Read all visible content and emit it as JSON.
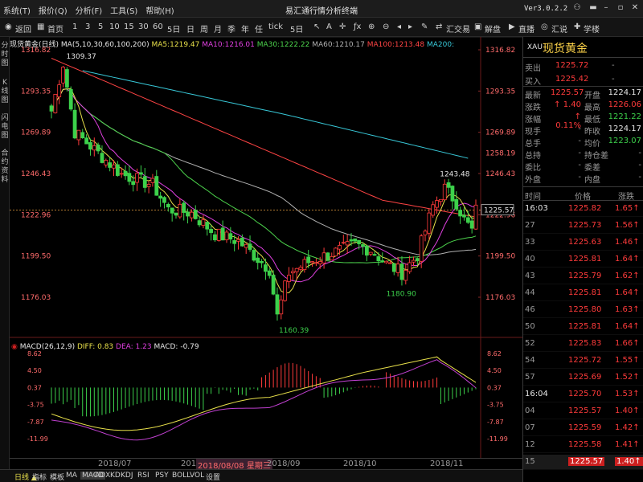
{
  "window": {
    "menus": [
      "系统(T)",
      "报价(Q)",
      "分析(F)",
      "工具(S)",
      "帮助(H)"
    ],
    "title": "易汇通行情分析终端",
    "version": "Ver3.0.2.2"
  },
  "toolbar": {
    "back": "返回",
    "home": "首页",
    "periods": [
      "1",
      "3",
      "5",
      "10",
      "15",
      "30",
      "60",
      "5日",
      "日",
      "周",
      "月",
      "季",
      "年",
      "任",
      "tick",
      "5日"
    ],
    "right_tools": [
      "汇交易",
      "解盘",
      "直播",
      "汇说",
      "学楼"
    ]
  },
  "sidebar": {
    "tabs": [
      "分\n时\n图",
      "K\n线\n图",
      "闪\n电\n图",
      "合\n约\n资\n料"
    ]
  },
  "chart": {
    "legend_name": "现货黄金(日线)",
    "legend_params": "MA(5,10,30,60,100,200)",
    "ma_values": [
      {
        "label": "MA5:1219.47",
        "color": "#e8e04a"
      },
      {
        "label": "MA10:1216.01",
        "color": "#e040e0"
      },
      {
        "label": "MA30:1222.22",
        "color": "#4cd24c"
      },
      {
        "label": "MA60:1210.17",
        "color": "#b0b0b0"
      },
      {
        "label": "MA100:1213.48",
        "color": "#ff4444"
      },
      {
        "label": "MA200:",
        "color": "#38c8d8"
      }
    ],
    "price_axis": [
      "1316.82",
      "1293.35",
      "1269.89",
      "1246.43",
      "1222.96",
      "1199.50",
      "1176.03"
    ],
    "right_axis_extra": "1258.19",
    "current_price_tag": "1225.57",
    "annotations": {
      "high_left": "1309.37",
      "low": "1160.39",
      "low2": "1180.90",
      "high_right": "1243.48"
    },
    "macd_legend": {
      "name": "MACD(26,12,9)",
      "diff": "DIFF: 0.83",
      "dea": "DEA: 1.23",
      "macd": "MACD: -0.79"
    },
    "macd_axis": [
      "8.62",
      "4.50",
      "0.37",
      "-3.75",
      "-7.87",
      "-11.99"
    ],
    "dates": [
      "2018/07",
      "2018/08/08 星期三",
      "2018/09",
      "2018/10",
      "2018/11"
    ],
    "date_cursor_prefix": "2018/",
    "colors": {
      "up": "#ff3b3b",
      "down": "#3cd14b",
      "ma200": "#38c8d8",
      "dif": "#e8e04a",
      "dea": "#c040d0"
    }
  },
  "bottom_tabs": [
    "日线 ▲",
    "指标",
    "模板",
    "MA",
    "MACD",
    "ADX",
    "KD",
    "KDJ",
    "RSI",
    "PSY",
    "BOLL",
    "VOL",
    "设置"
  ],
  "quote": {
    "symbol": "XAU",
    "name": "现货黄金",
    "sell": {
      "label": "卖出",
      "value": "1225.72",
      "extra": "-"
    },
    "buy": {
      "label": "买入",
      "value": "1225.42",
      "extra": "-"
    },
    "rows": [
      {
        "l1": "最新",
        "v1": "1225.57",
        "l2": "开盘",
        "v2": "1224.17"
      },
      {
        "l1": "涨跌",
        "v1": "↑ 1.40",
        "l2": "最高",
        "v2": "1226.06"
      },
      {
        "l1": "涨幅",
        "v1": "↑ 0.11%",
        "l2": "最低",
        "v2": "1221.22"
      },
      {
        "l1": "现手",
        "v1": "-",
        "l2": "昨收",
        "v2": "1224.17"
      },
      {
        "l1": "总手",
        "v1": "-",
        "l2": "均价",
        "v2": "1223.07"
      },
      {
        "l1": "总持",
        "v1": "-",
        "l2": "持仓差",
        "v2": "-"
      },
      {
        "l1": "委比",
        "v1": "-",
        "l2": "委差",
        "v2": "-"
      },
      {
        "l1": "外盘",
        "v1": "-",
        "l2": "内盘",
        "v2": "-"
      }
    ],
    "ticks_header": {
      "time": "时间",
      "price": "价格",
      "change": "涨跌"
    },
    "ticks": [
      {
        "time": "16:03",
        "price": "1225.82",
        "change": "1.65↑"
      },
      {
        "time": "27",
        "price": "1225.73",
        "change": "1.56↑"
      },
      {
        "time": "33",
        "price": "1225.63",
        "change": "1.46↑"
      },
      {
        "time": "40",
        "price": "1225.81",
        "change": "1.64↑"
      },
      {
        "time": "43",
        "price": "1225.79",
        "change": "1.62↑"
      },
      {
        "time": "44",
        "price": "1225.81",
        "change": "1.64↑"
      },
      {
        "time": "46",
        "price": "1225.80",
        "change": "1.63↑"
      },
      {
        "time": "50",
        "price": "1225.81",
        "change": "1.64↑"
      },
      {
        "time": "52",
        "price": "1225.83",
        "change": "1.66↑"
      },
      {
        "time": "54",
        "price": "1225.72",
        "change": "1.55↑"
      },
      {
        "time": "57",
        "price": "1225.69",
        "change": "1.52↑"
      },
      {
        "time": "16:04",
        "price": "1225.70",
        "change": "1.53↑"
      },
      {
        "time": "04",
        "price": "1225.57",
        "change": "1.40↑"
      },
      {
        "time": "07",
        "price": "1225.59",
        "change": "1.42↑"
      },
      {
        "time": "12",
        "price": "1225.58",
        "change": "1.41↑"
      },
      {
        "time": "15",
        "price": "1225.57",
        "change": "1.40↑"
      }
    ]
  }
}
